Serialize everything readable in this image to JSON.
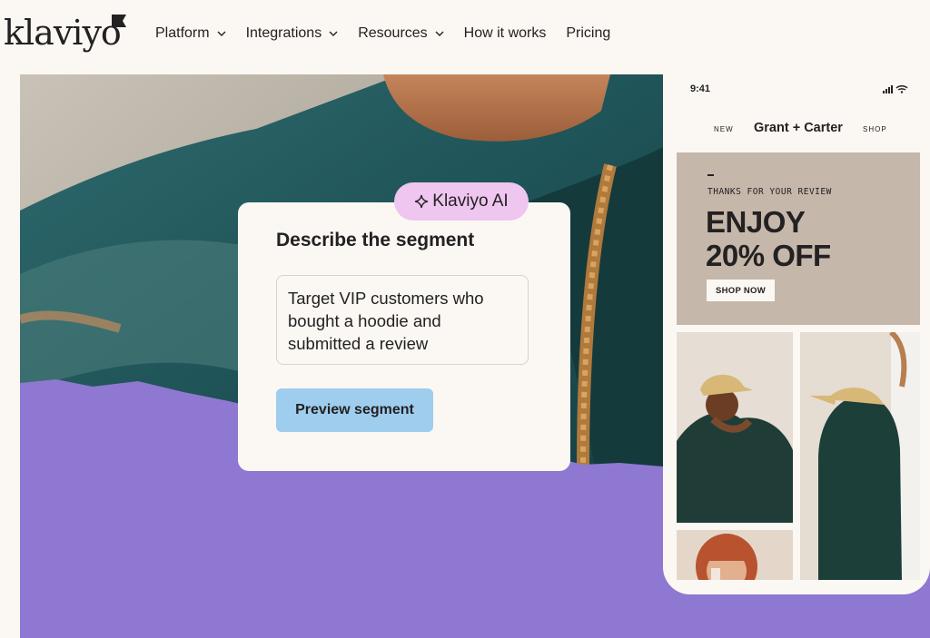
{
  "brand": {
    "logo_text": "klaviyo"
  },
  "nav": {
    "items": [
      {
        "label": "Platform",
        "has_menu": true
      },
      {
        "label": "Integrations",
        "has_menu": true
      },
      {
        "label": "Resources",
        "has_menu": true
      },
      {
        "label": "How it works",
        "has_menu": false
      },
      {
        "label": "Pricing",
        "has_menu": false
      }
    ]
  },
  "segment_card": {
    "badge": "Klaviyo AI",
    "title": "Describe the segment",
    "input_value": "Target VIP customers who bought a hoodie and submitted a review",
    "button_label": "Preview segment"
  },
  "phone": {
    "time": "9:41",
    "nav_left": "NEW",
    "brand": "Grant + Carter",
    "nav_right": "SHOP",
    "promo": {
      "subtitle": "THANKS FOR YOUR REVIEW",
      "headline_line1": "ENJOY",
      "headline_line2": "20% OFF",
      "button": "SHOP NOW"
    }
  },
  "colors": {
    "background": "#fbf8f3",
    "purple": "#8e78d1",
    "ai_badge": "#eec6f0",
    "button_blue": "#9fcdee",
    "promo_bg": "#c6b7ab",
    "text": "#232121"
  }
}
